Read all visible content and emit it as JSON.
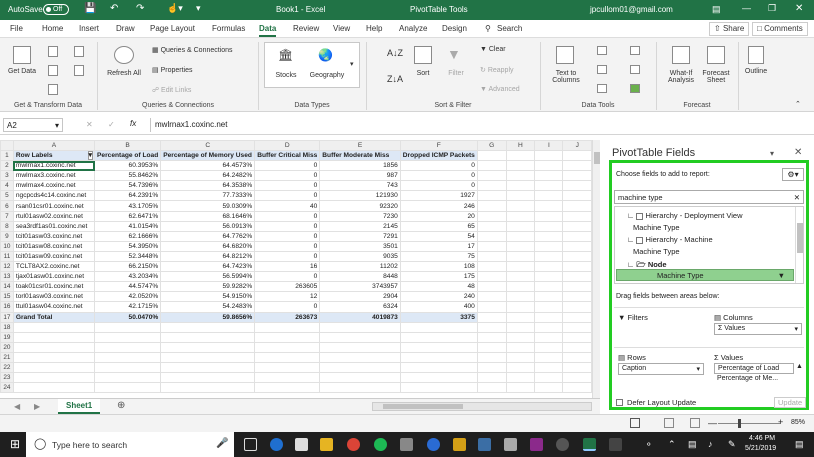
{
  "title_bar": {
    "autosave_label": "AutoSave",
    "autosave_state": "Off",
    "doc_title": "Book1 - Excel",
    "context_title": "PivotTable Tools",
    "account": "jpcullom01@gmail.com"
  },
  "menu": {
    "tabs": [
      "File",
      "Home",
      "Insert",
      "Draw",
      "Page Layout",
      "Formulas",
      "Data",
      "Review",
      "View",
      "Help",
      "Analyze",
      "Design"
    ],
    "active": "Data",
    "search": "Search",
    "share": "Share",
    "comments": "Comments"
  },
  "ribbon": {
    "get_data": "Get Data",
    "queries_connections": "Queries & Connections",
    "properties": "Properties",
    "edit_links": "Edit Links",
    "refresh_all": "Refresh All",
    "stocks": "Stocks",
    "geography": "Geography",
    "sort": "Sort",
    "filter": "Filter",
    "clear": "Clear",
    "reapply": "Reapply",
    "advanced": "Advanced",
    "text_to_columns": "Text to Columns",
    "what_if": "What-If Analysis",
    "forecast_sheet": "Forecast Sheet",
    "outline": "Outline",
    "groups": {
      "get_transform": "Get & Transform Data",
      "queries": "Queries & Connections",
      "data_types": "Data Types",
      "sort_filter": "Sort & Filter",
      "data_tools": "Data Tools",
      "forecast": "Forecast"
    }
  },
  "formula_bar": {
    "name_box": "A2",
    "fx": "fx",
    "value": "mwlrnax1.coxinc.net"
  },
  "sheet": {
    "columns": [
      "A",
      "B",
      "C",
      "D",
      "E",
      "F",
      "G",
      "H",
      "I",
      "J"
    ],
    "headers": [
      "Row Labels",
      "Percentage of Load",
      "Percentage of Memory Used",
      "Buffer Critical Miss",
      "Buffer Moderate Miss",
      "Dropped ICMP Packets"
    ],
    "rows": [
      [
        "mwlrnax1.coxinc.net",
        "60.3953%",
        "64.4573%",
        "0",
        "1856",
        "0"
      ],
      [
        "mwlrnax3.coxinc.net",
        "55.8462%",
        "64.2482%",
        "0",
        "987",
        "0"
      ],
      [
        "mwlrnax4.coxinc.net",
        "54.7396%",
        "64.3538%",
        "0",
        "743",
        "0"
      ],
      [
        "ngcpcds4c14.coxinc.net",
        "64.2391%",
        "77.7333%",
        "0",
        "121930",
        "1927"
      ],
      [
        "rsan01csr01.coxinc.net",
        "43.1705%",
        "59.0309%",
        "40",
        "92320",
        "246"
      ],
      [
        "rtul01asw02.coxinc.net",
        "62.6471%",
        "68.1646%",
        "0",
        "7230",
        "20"
      ],
      [
        "sea3rdf1as01.coxinc.net",
        "41.0154%",
        "56.0913%",
        "0",
        "2145",
        "65"
      ],
      [
        "tcit01asw03.coxinc.net",
        "62.1666%",
        "64.7762%",
        "0",
        "7291",
        "54"
      ],
      [
        "tcit01asw08.coxinc.net",
        "54.3950%",
        "64.6820%",
        "0",
        "3501",
        "17"
      ],
      [
        "tcit01asw09.coxinc.net",
        "52.3448%",
        "64.8212%",
        "0",
        "9035",
        "75"
      ],
      [
        "TCLT8AX2.coxinc.net",
        "66.2150%",
        "64.7423%",
        "16",
        "11202",
        "108"
      ],
      [
        "tjax01asw01.coxinc.net",
        "43.2034%",
        "56.5994%",
        "0",
        "8448",
        "175"
      ],
      [
        "toak01csr01.coxinc.net",
        "44.5747%",
        "59.9282%",
        "263605",
        "3743957",
        "48"
      ],
      [
        "torl01asw03.coxinc.net",
        "42.0520%",
        "54.9150%",
        "12",
        "2904",
        "240"
      ],
      [
        "ttul01asw04.coxinc.net",
        "42.1715%",
        "54.2483%",
        "0",
        "6324",
        "400"
      ]
    ],
    "total": [
      "Grand Total",
      "50.0470%",
      "59.8656%",
      "263673",
      "4019873",
      "3375"
    ],
    "row_numbers": [
      "1",
      "2",
      "3",
      "4",
      "5",
      "6",
      "7",
      "8",
      "9",
      "10",
      "11",
      "12",
      "13",
      "14",
      "15",
      "16",
      "17",
      "18",
      "19",
      "20",
      "21",
      "22",
      "23",
      "24"
    ],
    "sheet_tab": "Sheet1"
  },
  "pivot": {
    "title": "PivotTable Fields",
    "choose_label": "Choose fields to add to report:",
    "search_value": "machine type",
    "tree": [
      {
        "text": "Hierarchy - Deployment View",
        "kind": "parent"
      },
      {
        "text": "Machine Type",
        "kind": "child"
      },
      {
        "text": "Hierarchy - Machine",
        "kind": "parent"
      },
      {
        "text": "Machine Type",
        "kind": "child"
      },
      {
        "text": "Node",
        "kind": "node"
      },
      {
        "text": "Machine Type",
        "kind": "selected"
      }
    ],
    "drag_label": "Drag fields between areas below:",
    "filters_label": "Filters",
    "columns_label": "Columns",
    "columns_value": "Values",
    "rows_label": "Rows",
    "rows_value": "Caption",
    "values_label": "Values",
    "values_items": [
      "Percentage of Load",
      "Percentage of Me..."
    ],
    "defer_label": "Defer Layout Update",
    "update_label": "Update"
  },
  "status": {
    "zoom": "85%"
  },
  "taskbar": {
    "search_placeholder": "Type here to search",
    "time": "4:46 PM",
    "date": "5/21/2019"
  },
  "colors": {
    "excel_green": "#217346",
    "highlight": "#22cc22",
    "header_fill": "#dde8f6"
  }
}
